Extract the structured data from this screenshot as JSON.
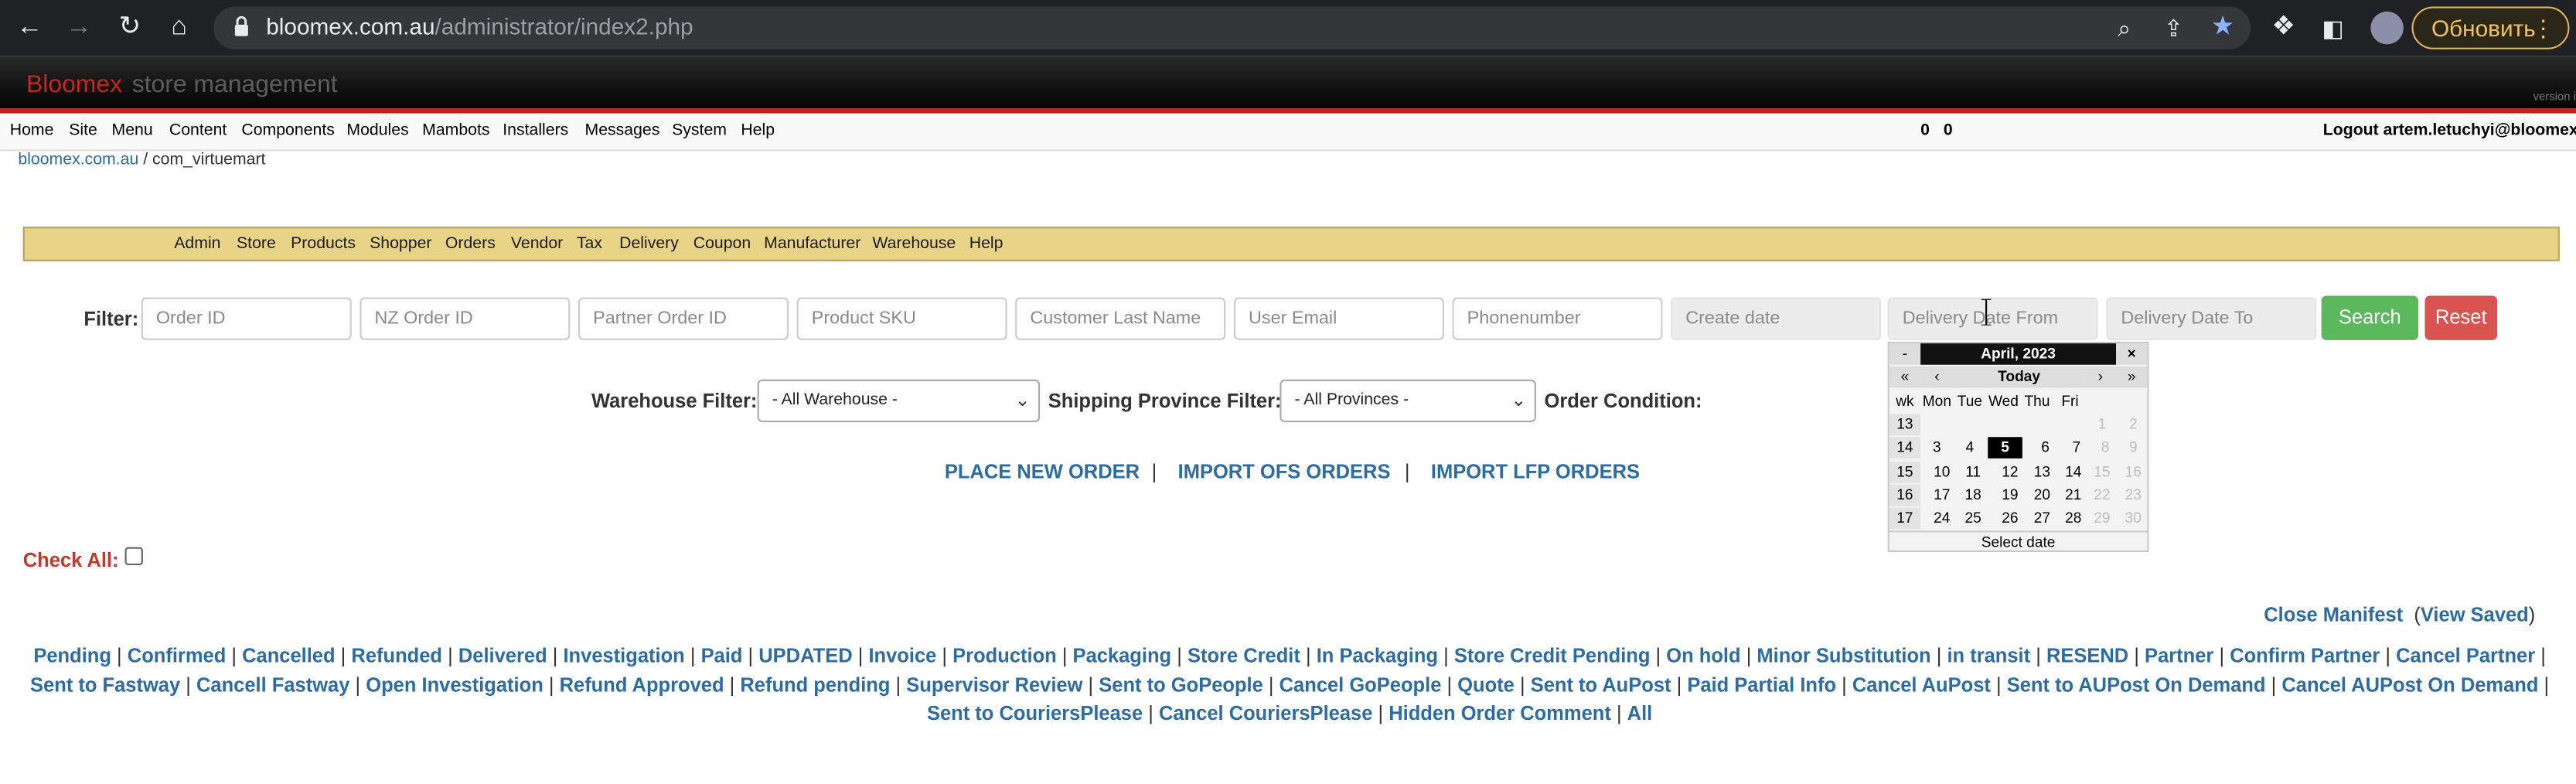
{
  "browser": {
    "url_host": "bloomex.com.au",
    "url_path": "/administrator/index2.php",
    "update_label": "Обновить",
    "icons": [
      "back-icon",
      "forward-icon",
      "reload-icon",
      "home-icon",
      "zoom-icon",
      "share-icon",
      "star-icon",
      "extensions-icon",
      "sidebar-icon",
      "profile-icon",
      "menu-icon"
    ]
  },
  "header": {
    "brand": "Bloomex",
    "subtitle": "store management",
    "version": "version i"
  },
  "menu": {
    "items": [
      "Home",
      "Site",
      "Menu",
      "Content",
      "Components",
      "Modules",
      "Mambots",
      "Installers",
      "Messages",
      "System",
      "Help"
    ],
    "counter1": "0",
    "counter2": "0",
    "logout": "Logout artem.letuchyi@bloomex.ca"
  },
  "breadcrumb": {
    "site": "bloomex.com.au",
    "separator": " / ",
    "page": "com_virtuemart"
  },
  "vm_toolbar": {
    "items": [
      "Admin",
      "Store",
      "Products",
      "Shopper",
      "Orders",
      "Vendor",
      "Tax",
      "Delivery",
      "Coupon",
      "Manufacturer",
      "Warehouse",
      "Help"
    ]
  },
  "filters": {
    "label": "Filter:",
    "order_id": "Order ID",
    "nz_order_id": "NZ Order ID",
    "partner_order_id": "Partner Order ID",
    "product_sku": "Product SKU",
    "customer_last_name": "Customer Last Name",
    "user_email": "User Email",
    "phone": "Phonenumber",
    "create_date": "Create date",
    "delivery_from": "Delivery Date From",
    "delivery_to": "Delivery Date To",
    "search": "Search",
    "reset": "Reset",
    "warehouse_label": "Warehouse Filter:",
    "warehouse_value": "- All Warehouse -",
    "province_label": "Shipping Province Filter:",
    "province_value": "- All Provinces -",
    "condition_label": "Order Condition:",
    "search_color": "#5cb85c",
    "reset_color": "#d9534f"
  },
  "actions": {
    "place_order": "PLACE NEW ORDER",
    "import_ofs": "IMPORT OFS ORDERS",
    "import_lfp": "IMPORT LFP ORDERS",
    "separator": "|"
  },
  "check_all": "Check All:",
  "calendar": {
    "month": "April, 2023",
    "minus": "-",
    "close": "×",
    "prev_year": "«",
    "prev_month": "‹",
    "today": "Today",
    "next_month": "›",
    "next_year": "»",
    "weekdays": [
      "wk",
      "Mon",
      "Tue",
      "Wed",
      "Thu",
      "Fri"
    ],
    "weeks": [
      {
        "wk": "13",
        "days": [
          "",
          "",
          "",
          "",
          ""
        ],
        "tail": [
          "1",
          "2"
        ]
      },
      {
        "wk": "14",
        "days": [
          "3",
          "4",
          "5",
          "6",
          "7"
        ],
        "tail": [
          "8",
          "9"
        ]
      },
      {
        "wk": "15",
        "days": [
          "10",
          "11",
          "12",
          "13",
          "14"
        ],
        "tail": [
          "15",
          "16"
        ]
      },
      {
        "wk": "16",
        "days": [
          "17",
          "18",
          "19",
          "20",
          "21"
        ],
        "tail": [
          "22",
          "23"
        ]
      },
      {
        "wk": "17",
        "days": [
          "24",
          "25",
          "26",
          "27",
          "28"
        ],
        "tail": [
          "29",
          "30"
        ]
      }
    ],
    "selected_day": "5",
    "footer": "Select date"
  },
  "manifest": {
    "close": "Close Manifest",
    "open_paren": "(",
    "view": "View Saved",
    "close_paren": ")"
  },
  "statuses": [
    "Pending",
    "Confirmed",
    "Cancelled",
    "Refunded",
    "Delivered",
    "Investigation",
    "Paid",
    "UPDATED",
    "Invoice",
    "Production",
    "Packaging",
    "Store Credit",
    "In Packaging",
    "Store Credit Pending",
    "On hold",
    "Minor Substitution",
    "in transit",
    "RESEND",
    "Partner",
    "Confirm Partner",
    "Cancel Partner",
    "Sent to Fastway",
    "Cancell Fastway",
    "Open Investigation",
    "Refund Approved",
    "Refund pending",
    "Supervisor Review",
    "Sent to GoPeople",
    "Cancel GoPeople",
    "Quote",
    "Sent to AuPost",
    "Paid Partial Info",
    "Cancel AuPost",
    "Sent to AUPost On Demand",
    "Cancel AUPost On Demand",
    "Sent to CouriersPlease",
    "Cancel CouriersPlease",
    "Hidden Order Comment",
    "All"
  ],
  "status_separator": "|"
}
